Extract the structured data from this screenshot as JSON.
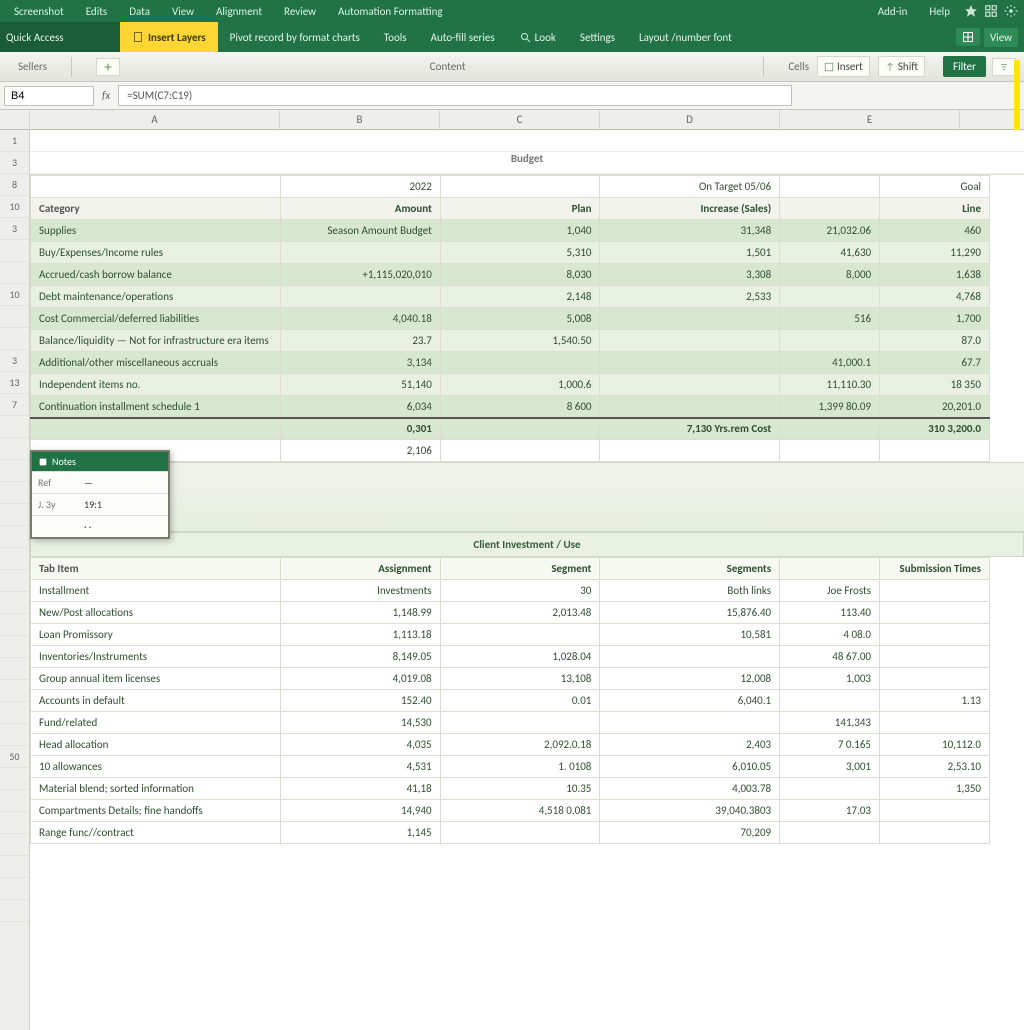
{
  "menubar": {
    "items": [
      "Screenshot",
      "Edits",
      "Data",
      "View",
      "Alignment",
      "Review",
      "Automation Formatting"
    ],
    "right_items": [
      "Add-in",
      "Help"
    ]
  },
  "ribbon": {
    "qat_label": "Quick Access",
    "tabs": [
      {
        "label": "Insert Layers",
        "active": true
      },
      {
        "label": "Pivot record by format charts"
      },
      {
        "label": "Tools"
      },
      {
        "label": "Auto-fill series"
      },
      {
        "label": "Look"
      },
      {
        "label": "Settings"
      },
      {
        "label": "Layout /number font"
      }
    ],
    "right_btn": "View",
    "right_ico": "grid-icon"
  },
  "subribbon": {
    "group1": "Sellers",
    "group2": "Cells",
    "dropdown_label": "Content",
    "btn1": "Insert",
    "btn2": "Shift",
    "green_chip": "Filter"
  },
  "formula": {
    "namebox": "B4",
    "label": "fx",
    "value": "=SUM(C7:C19)"
  },
  "columns": [
    "",
    "A",
    "B",
    "C",
    "D",
    "E"
  ],
  "top_blank_count": 2,
  "page_title": "Budget",
  "table1": {
    "period_row": [
      "",
      "2022",
      "",
      "On Target 05/06",
      "",
      "Goal"
    ],
    "header": [
      "Category",
      "Amount",
      "Plan",
      "Increase (Sales)",
      "",
      "Line"
    ],
    "rows": [
      [
        "Supplies",
        "Season Amount Budget",
        "1,040",
        "31,348",
        "21,032.06",
        "460"
      ],
      [
        "Buy/Expenses/Income rules",
        "",
        "5,310",
        "1,501",
        "41,630",
        "11,290"
      ],
      [
        "Accrued/cash borrow balance",
        "+1,115,020,010",
        "8,030",
        "3,308",
        "8,000",
        "1,638"
      ],
      [
        "Debt maintenance/operations",
        "",
        "2,148",
        "2,533",
        "",
        "4,768"
      ],
      [
        "Cost Commercial/deferred liabilities",
        "4,040.18",
        "5,008",
        "",
        "516",
        "1,700"
      ],
      [
        "Balance/liquidity — Not for infrastructure era items",
        "23.7",
        "1,540.50",
        "",
        "",
        "87.0"
      ],
      [
        "Additional/other miscellaneous accruals",
        "3,134",
        "",
        "",
        "41,000.1",
        "67.7"
      ],
      [
        "Independent items no.",
        "51,140",
        "1,000.6",
        "",
        "11,110.30",
        "18 350"
      ],
      [
        "Continuation installment schedule 1",
        "6,034",
        "8 600",
        "",
        "1,399 80.09",
        "20,201.0"
      ]
    ],
    "total": [
      "",
      "0,301",
      "",
      "7,130 Yrs.rem Cost",
      "",
      "310 3,200.0"
    ],
    "footer_val": "2,106"
  },
  "float_panel": {
    "title": "Notes",
    "rows": [
      [
        "Ref",
        "—"
      ],
      [
        "J. 3y",
        "19:1"
      ],
      [
        "",
        "· ·"
      ]
    ]
  },
  "table2": {
    "title": "Client Investment / Use",
    "header": [
      "Tab Item",
      "Assignment",
      "Segment",
      "Segments",
      "",
      "Submission Times"
    ],
    "rows": [
      [
        "Installment",
        "Investments",
        "30",
        "Both links",
        "Joe Frosts",
        ""
      ],
      [
        "New/Post allocations",
        "1,148.99",
        "2,013.48",
        "15,876.40",
        "113.40",
        ""
      ],
      [
        "Loan Promissory",
        "1,113.18",
        "",
        "10,581",
        "4 08.0",
        ""
      ],
      [
        "Inventories/Instruments",
        "8,149.05",
        "1,028.04",
        "",
        "48 67.00",
        ""
      ],
      [
        "Group annual item licenses",
        "4,019.08",
        "13,108",
        "12,008",
        "1,003",
        ""
      ],
      [
        "Accounts in default",
        "152.40",
        "0.01",
        "6,040.1",
        "",
        "1.13"
      ],
      [
        "Fund/related",
        "14,530",
        "",
        "",
        "141,343",
        ""
      ],
      [
        "Head allocation",
        "4,035",
        "2,092.0.18",
        "2,403",
        "7 0.165",
        "10,112.0"
      ],
      [
        "10 allowances",
        "4,531",
        "1. 0108",
        "6,010.05",
        "3,001",
        "2,53.10"
      ],
      [
        "Material blend; sorted information",
        "41,18",
        "10.35",
        "4,003.78",
        "",
        "1,350"
      ],
      [
        "Compartments Details; fine handoffs",
        "14,940",
        "4,518 0.081",
        "39,040.3803",
        "17.03",
        ""
      ],
      [
        "Range func//contract",
        "1,145",
        "",
        "70,209",
        "",
        ""
      ]
    ]
  },
  "row_numbers_1": [
    "1",
    "3",
    "8",
    "10",
    "3",
    "10",
    "",
    "3",
    "13",
    "7"
  ],
  "row_numbers_2": [
    "",
    "",
    "",
    "",
    "",
    "",
    "",
    "50",
    "",
    "",
    "",
    ""
  ]
}
